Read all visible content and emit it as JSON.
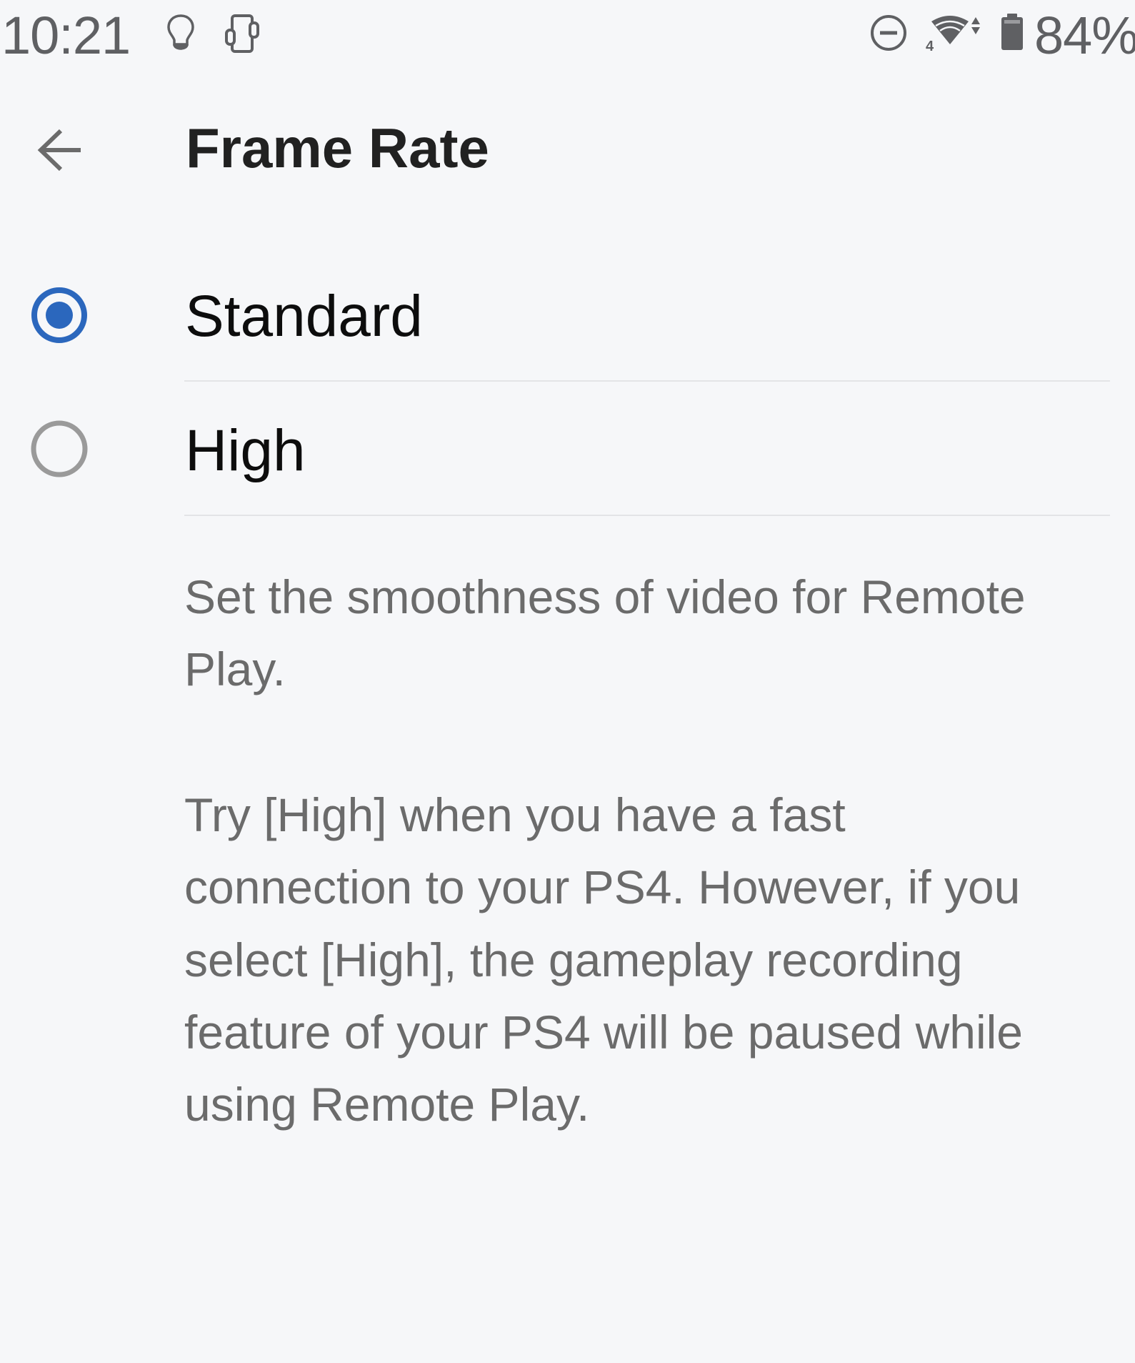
{
  "status_bar": {
    "time": "10:21",
    "left_icons": [
      "lightbulb-icon",
      "vibrate-phone-icon"
    ],
    "right_icons": [
      "do-not-disturb-icon",
      "wifi-4-signal-icon",
      "battery-icon"
    ],
    "wifi_badge": "4",
    "battery_percent": "84%"
  },
  "app_bar": {
    "back_icon": "arrow-back-icon",
    "title": "Frame Rate"
  },
  "options": [
    {
      "label": "Standard",
      "selected": true
    },
    {
      "label": "High",
      "selected": false
    }
  ],
  "description": {
    "paragraphs": [
      {
        "text": "Set the smoothness of video for Remote Play.",
        "lines": [
          "Set the smoothness of video for Remote",
          "Play."
        ]
      },
      {
        "text": "Try [High] when you have a fast connection to your PS4. However, if you select [High], the gameplay recording feature of your PS4 will be paused while using Remote Play.",
        "lines": [
          "Try [High] when you have a fast",
          "connection to your PS4. However, if you",
          "select [High], the gameplay recording",
          "feature of your PS4 will be paused while",
          "using Remote Play."
        ]
      }
    ]
  },
  "colors": {
    "background": "#f6f7f9",
    "accent": "#2b67bd",
    "radio_unselected": "#9a9a9a",
    "title_text": "#212121",
    "body_text": "#6b6b6b",
    "status_icons": "#5f6063",
    "divider": "#e3e4e7"
  }
}
